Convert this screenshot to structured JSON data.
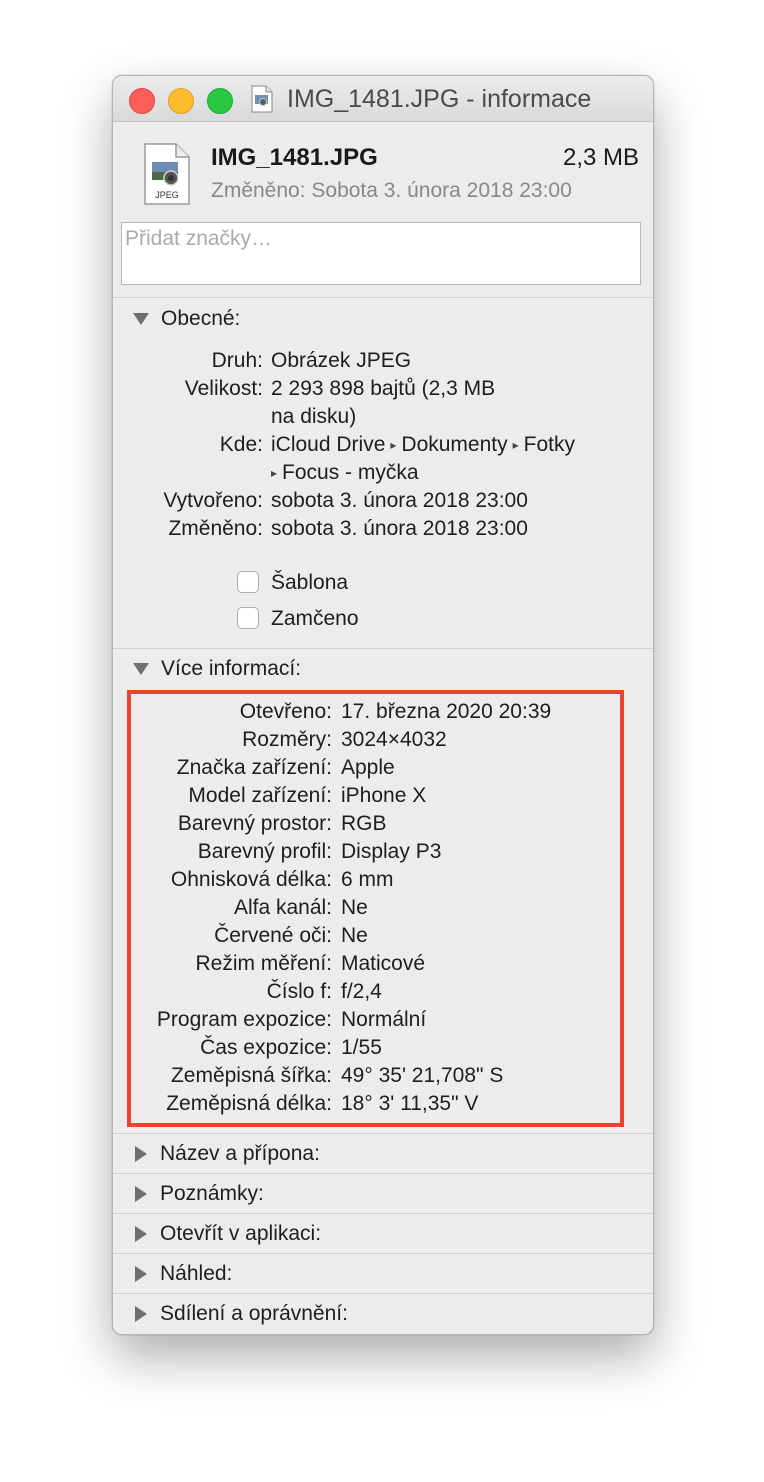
{
  "window": {
    "title": "IMG_1481.JPG - informace"
  },
  "header": {
    "file_name": "IMG_1481.JPG",
    "file_size": "2,3 MB",
    "modified": "Změněno: Sobota 3. února 2018 23:00",
    "icon_label": "JPEG"
  },
  "tags": {
    "placeholder": "Přidat značky…"
  },
  "general": {
    "heading": "Obecné:",
    "rows": [
      {
        "label": "Druh:",
        "value": "Obrázek JPEG"
      },
      {
        "label": "Velikost:",
        "value": "2 293 898 bajtů (2,3 MB",
        "value2": "na disku)"
      },
      {
        "label": "Kde:",
        "path": [
          "iCloud Drive",
          "Dokumenty",
          "Fotky",
          "Focus - myčka"
        ]
      },
      {
        "label": "Vytvořeno:",
        "value": "sobota 3. února 2018 23:00"
      },
      {
        "label": "Změněno:",
        "value": "sobota 3. února 2018 23:00"
      }
    ],
    "template_label": "Šablona",
    "locked_label": "Zamčeno",
    "template_checked": false,
    "locked_checked": false
  },
  "more_info": {
    "heading": "Více informací:",
    "rows": [
      {
        "label": "Otevřeno:",
        "value": "17. března 2020 20:39"
      },
      {
        "label": "Rozměry:",
        "value": "3024×4032"
      },
      {
        "label": "Značka zařízení:",
        "value": "Apple"
      },
      {
        "label": "Model zařízení:",
        "value": "iPhone X"
      },
      {
        "label": "Barevný prostor:",
        "value": "RGB"
      },
      {
        "label": "Barevný profil:",
        "value": "Display P3"
      },
      {
        "label": "Ohnisková délka:",
        "value": "6 mm"
      },
      {
        "label": "Alfa kanál:",
        "value": "Ne"
      },
      {
        "label": "Červené oči:",
        "value": "Ne"
      },
      {
        "label": "Režim měření:",
        "value": "Maticové"
      },
      {
        "label": "Číslo f:",
        "value": "f/2,4"
      },
      {
        "label": "Program expozice:",
        "value": "Normální"
      },
      {
        "label": "Čas expozice:",
        "value": "1/55"
      },
      {
        "label": "Zeměpisná šířka:",
        "value": "49° 35' 21,708\" S"
      },
      {
        "label": "Zeměpisná délka:",
        "value": "18° 3' 11,35\" V"
      }
    ]
  },
  "collapsed_sections": [
    "Název a přípona:",
    "Poznámky:",
    "Otevřít v aplikaci:",
    "Náhled:",
    "Sdílení a oprávnění:"
  ],
  "colors": {
    "highlight": "#e8462b",
    "close": "#fc5f57",
    "minimize": "#fdbc2e",
    "zoom": "#28c840"
  }
}
